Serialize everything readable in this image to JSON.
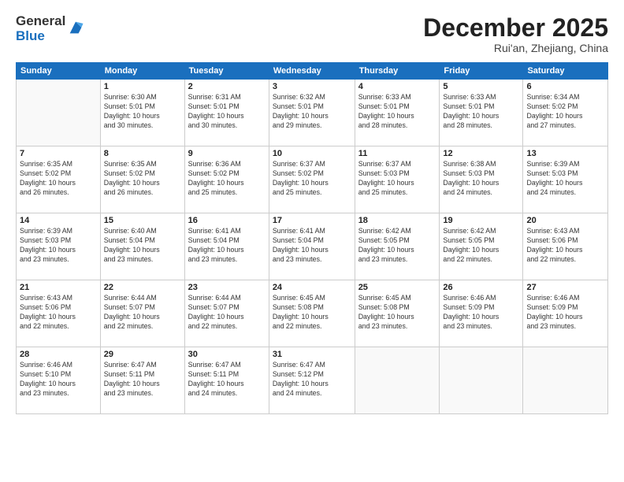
{
  "logo": {
    "general": "General",
    "blue": "Blue"
  },
  "header": {
    "month": "December 2025",
    "location": "Rui'an, Zhejiang, China"
  },
  "weekdays": [
    "Sunday",
    "Monday",
    "Tuesday",
    "Wednesday",
    "Thursday",
    "Friday",
    "Saturday"
  ],
  "weeks": [
    [
      {
        "day": "",
        "info": ""
      },
      {
        "day": "1",
        "info": "Sunrise: 6:30 AM\nSunset: 5:01 PM\nDaylight: 10 hours\nand 30 minutes."
      },
      {
        "day": "2",
        "info": "Sunrise: 6:31 AM\nSunset: 5:01 PM\nDaylight: 10 hours\nand 30 minutes."
      },
      {
        "day": "3",
        "info": "Sunrise: 6:32 AM\nSunset: 5:01 PM\nDaylight: 10 hours\nand 29 minutes."
      },
      {
        "day": "4",
        "info": "Sunrise: 6:33 AM\nSunset: 5:01 PM\nDaylight: 10 hours\nand 28 minutes."
      },
      {
        "day": "5",
        "info": "Sunrise: 6:33 AM\nSunset: 5:01 PM\nDaylight: 10 hours\nand 28 minutes."
      },
      {
        "day": "6",
        "info": "Sunrise: 6:34 AM\nSunset: 5:02 PM\nDaylight: 10 hours\nand 27 minutes."
      }
    ],
    [
      {
        "day": "7",
        "info": "Sunrise: 6:35 AM\nSunset: 5:02 PM\nDaylight: 10 hours\nand 26 minutes."
      },
      {
        "day": "8",
        "info": "Sunrise: 6:35 AM\nSunset: 5:02 PM\nDaylight: 10 hours\nand 26 minutes."
      },
      {
        "day": "9",
        "info": "Sunrise: 6:36 AM\nSunset: 5:02 PM\nDaylight: 10 hours\nand 25 minutes."
      },
      {
        "day": "10",
        "info": "Sunrise: 6:37 AM\nSunset: 5:02 PM\nDaylight: 10 hours\nand 25 minutes."
      },
      {
        "day": "11",
        "info": "Sunrise: 6:37 AM\nSunset: 5:03 PM\nDaylight: 10 hours\nand 25 minutes."
      },
      {
        "day": "12",
        "info": "Sunrise: 6:38 AM\nSunset: 5:03 PM\nDaylight: 10 hours\nand 24 minutes."
      },
      {
        "day": "13",
        "info": "Sunrise: 6:39 AM\nSunset: 5:03 PM\nDaylight: 10 hours\nand 24 minutes."
      }
    ],
    [
      {
        "day": "14",
        "info": "Sunrise: 6:39 AM\nSunset: 5:03 PM\nDaylight: 10 hours\nand 23 minutes."
      },
      {
        "day": "15",
        "info": "Sunrise: 6:40 AM\nSunset: 5:04 PM\nDaylight: 10 hours\nand 23 minutes."
      },
      {
        "day": "16",
        "info": "Sunrise: 6:41 AM\nSunset: 5:04 PM\nDaylight: 10 hours\nand 23 minutes."
      },
      {
        "day": "17",
        "info": "Sunrise: 6:41 AM\nSunset: 5:04 PM\nDaylight: 10 hours\nand 23 minutes."
      },
      {
        "day": "18",
        "info": "Sunrise: 6:42 AM\nSunset: 5:05 PM\nDaylight: 10 hours\nand 23 minutes."
      },
      {
        "day": "19",
        "info": "Sunrise: 6:42 AM\nSunset: 5:05 PM\nDaylight: 10 hours\nand 22 minutes."
      },
      {
        "day": "20",
        "info": "Sunrise: 6:43 AM\nSunset: 5:06 PM\nDaylight: 10 hours\nand 22 minutes."
      }
    ],
    [
      {
        "day": "21",
        "info": "Sunrise: 6:43 AM\nSunset: 5:06 PM\nDaylight: 10 hours\nand 22 minutes."
      },
      {
        "day": "22",
        "info": "Sunrise: 6:44 AM\nSunset: 5:07 PM\nDaylight: 10 hours\nand 22 minutes."
      },
      {
        "day": "23",
        "info": "Sunrise: 6:44 AM\nSunset: 5:07 PM\nDaylight: 10 hours\nand 22 minutes."
      },
      {
        "day": "24",
        "info": "Sunrise: 6:45 AM\nSunset: 5:08 PM\nDaylight: 10 hours\nand 22 minutes."
      },
      {
        "day": "25",
        "info": "Sunrise: 6:45 AM\nSunset: 5:08 PM\nDaylight: 10 hours\nand 23 minutes."
      },
      {
        "day": "26",
        "info": "Sunrise: 6:46 AM\nSunset: 5:09 PM\nDaylight: 10 hours\nand 23 minutes."
      },
      {
        "day": "27",
        "info": "Sunrise: 6:46 AM\nSunset: 5:09 PM\nDaylight: 10 hours\nand 23 minutes."
      }
    ],
    [
      {
        "day": "28",
        "info": "Sunrise: 6:46 AM\nSunset: 5:10 PM\nDaylight: 10 hours\nand 23 minutes."
      },
      {
        "day": "29",
        "info": "Sunrise: 6:47 AM\nSunset: 5:11 PM\nDaylight: 10 hours\nand 23 minutes."
      },
      {
        "day": "30",
        "info": "Sunrise: 6:47 AM\nSunset: 5:11 PM\nDaylight: 10 hours\nand 24 minutes."
      },
      {
        "day": "31",
        "info": "Sunrise: 6:47 AM\nSunset: 5:12 PM\nDaylight: 10 hours\nand 24 minutes."
      },
      {
        "day": "",
        "info": ""
      },
      {
        "day": "",
        "info": ""
      },
      {
        "day": "",
        "info": ""
      }
    ]
  ]
}
